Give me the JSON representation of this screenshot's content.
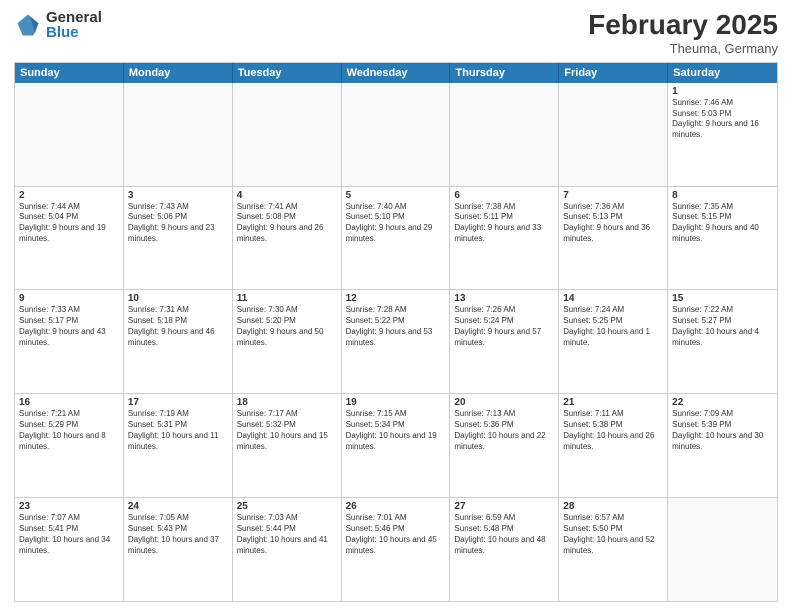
{
  "logo": {
    "general": "General",
    "blue": "Blue"
  },
  "header": {
    "month": "February 2025",
    "location": "Theuma, Germany"
  },
  "calendar": {
    "days": [
      "Sunday",
      "Monday",
      "Tuesday",
      "Wednesday",
      "Thursday",
      "Friday",
      "Saturday"
    ],
    "rows": [
      [
        {
          "day": "",
          "empty": true
        },
        {
          "day": "",
          "empty": true
        },
        {
          "day": "",
          "empty": true
        },
        {
          "day": "",
          "empty": true
        },
        {
          "day": "",
          "empty": true
        },
        {
          "day": "",
          "empty": true
        },
        {
          "day": "1",
          "sunrise": "Sunrise: 7:46 AM",
          "sunset": "Sunset: 5:03 PM",
          "daylight": "Daylight: 9 hours and 16 minutes."
        }
      ],
      [
        {
          "day": "2",
          "sunrise": "Sunrise: 7:44 AM",
          "sunset": "Sunset: 5:04 PM",
          "daylight": "Daylight: 9 hours and 19 minutes."
        },
        {
          "day": "3",
          "sunrise": "Sunrise: 7:43 AM",
          "sunset": "Sunset: 5:06 PM",
          "daylight": "Daylight: 9 hours and 23 minutes."
        },
        {
          "day": "4",
          "sunrise": "Sunrise: 7:41 AM",
          "sunset": "Sunset: 5:08 PM",
          "daylight": "Daylight: 9 hours and 26 minutes."
        },
        {
          "day": "5",
          "sunrise": "Sunrise: 7:40 AM",
          "sunset": "Sunset: 5:10 PM",
          "daylight": "Daylight: 9 hours and 29 minutes."
        },
        {
          "day": "6",
          "sunrise": "Sunrise: 7:38 AM",
          "sunset": "Sunset: 5:11 PM",
          "daylight": "Daylight: 9 hours and 33 minutes."
        },
        {
          "day": "7",
          "sunrise": "Sunrise: 7:36 AM",
          "sunset": "Sunset: 5:13 PM",
          "daylight": "Daylight: 9 hours and 36 minutes."
        },
        {
          "day": "8",
          "sunrise": "Sunrise: 7:35 AM",
          "sunset": "Sunset: 5:15 PM",
          "daylight": "Daylight: 9 hours and 40 minutes."
        }
      ],
      [
        {
          "day": "9",
          "sunrise": "Sunrise: 7:33 AM",
          "sunset": "Sunset: 5:17 PM",
          "daylight": "Daylight: 9 hours and 43 minutes."
        },
        {
          "day": "10",
          "sunrise": "Sunrise: 7:31 AM",
          "sunset": "Sunset: 5:18 PM",
          "daylight": "Daylight: 9 hours and 46 minutes."
        },
        {
          "day": "11",
          "sunrise": "Sunrise: 7:30 AM",
          "sunset": "Sunset: 5:20 PM",
          "daylight": "Daylight: 9 hours and 50 minutes."
        },
        {
          "day": "12",
          "sunrise": "Sunrise: 7:28 AM",
          "sunset": "Sunset: 5:22 PM",
          "daylight": "Daylight: 9 hours and 53 minutes."
        },
        {
          "day": "13",
          "sunrise": "Sunrise: 7:26 AM",
          "sunset": "Sunset: 5:24 PM",
          "daylight": "Daylight: 9 hours and 57 minutes."
        },
        {
          "day": "14",
          "sunrise": "Sunrise: 7:24 AM",
          "sunset": "Sunset: 5:25 PM",
          "daylight": "Daylight: 10 hours and 1 minute."
        },
        {
          "day": "15",
          "sunrise": "Sunrise: 7:22 AM",
          "sunset": "Sunset: 5:27 PM",
          "daylight": "Daylight: 10 hours and 4 minutes."
        }
      ],
      [
        {
          "day": "16",
          "sunrise": "Sunrise: 7:21 AM",
          "sunset": "Sunset: 5:29 PM",
          "daylight": "Daylight: 10 hours and 8 minutes."
        },
        {
          "day": "17",
          "sunrise": "Sunrise: 7:19 AM",
          "sunset": "Sunset: 5:31 PM",
          "daylight": "Daylight: 10 hours and 11 minutes."
        },
        {
          "day": "18",
          "sunrise": "Sunrise: 7:17 AM",
          "sunset": "Sunset: 5:32 PM",
          "daylight": "Daylight: 10 hours and 15 minutes."
        },
        {
          "day": "19",
          "sunrise": "Sunrise: 7:15 AM",
          "sunset": "Sunset: 5:34 PM",
          "daylight": "Daylight: 10 hours and 19 minutes."
        },
        {
          "day": "20",
          "sunrise": "Sunrise: 7:13 AM",
          "sunset": "Sunset: 5:36 PM",
          "daylight": "Daylight: 10 hours and 22 minutes."
        },
        {
          "day": "21",
          "sunrise": "Sunrise: 7:11 AM",
          "sunset": "Sunset: 5:38 PM",
          "daylight": "Daylight: 10 hours and 26 minutes."
        },
        {
          "day": "22",
          "sunrise": "Sunrise: 7:09 AM",
          "sunset": "Sunset: 5:39 PM",
          "daylight": "Daylight: 10 hours and 30 minutes."
        }
      ],
      [
        {
          "day": "23",
          "sunrise": "Sunrise: 7:07 AM",
          "sunset": "Sunset: 5:41 PM",
          "daylight": "Daylight: 10 hours and 34 minutes."
        },
        {
          "day": "24",
          "sunrise": "Sunrise: 7:05 AM",
          "sunset": "Sunset: 5:43 PM",
          "daylight": "Daylight: 10 hours and 37 minutes."
        },
        {
          "day": "25",
          "sunrise": "Sunrise: 7:03 AM",
          "sunset": "Sunset: 5:44 PM",
          "daylight": "Daylight: 10 hours and 41 minutes."
        },
        {
          "day": "26",
          "sunrise": "Sunrise: 7:01 AM",
          "sunset": "Sunset: 5:46 PM",
          "daylight": "Daylight: 10 hours and 45 minutes."
        },
        {
          "day": "27",
          "sunrise": "Sunrise: 6:59 AM",
          "sunset": "Sunset: 5:48 PM",
          "daylight": "Daylight: 10 hours and 48 minutes."
        },
        {
          "day": "28",
          "sunrise": "Sunrise: 6:57 AM",
          "sunset": "Sunset: 5:50 PM",
          "daylight": "Daylight: 10 hours and 52 minutes."
        },
        {
          "day": "",
          "empty": true
        }
      ]
    ]
  }
}
